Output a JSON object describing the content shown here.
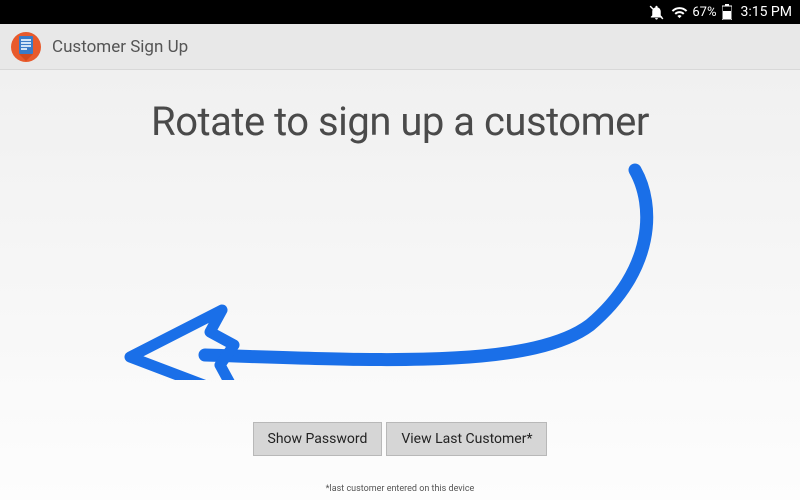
{
  "status": {
    "battery_percent": "67%",
    "clock": "3:15 PM"
  },
  "app_bar": {
    "title": "Customer Sign Up"
  },
  "headline": "Rotate to sign up a customer",
  "buttons": {
    "show_password": "Show Password",
    "view_last_customer": "View Last Customer*"
  },
  "footnote": "*last customer entered on this device",
  "arrow_color": "#1a6fe8"
}
